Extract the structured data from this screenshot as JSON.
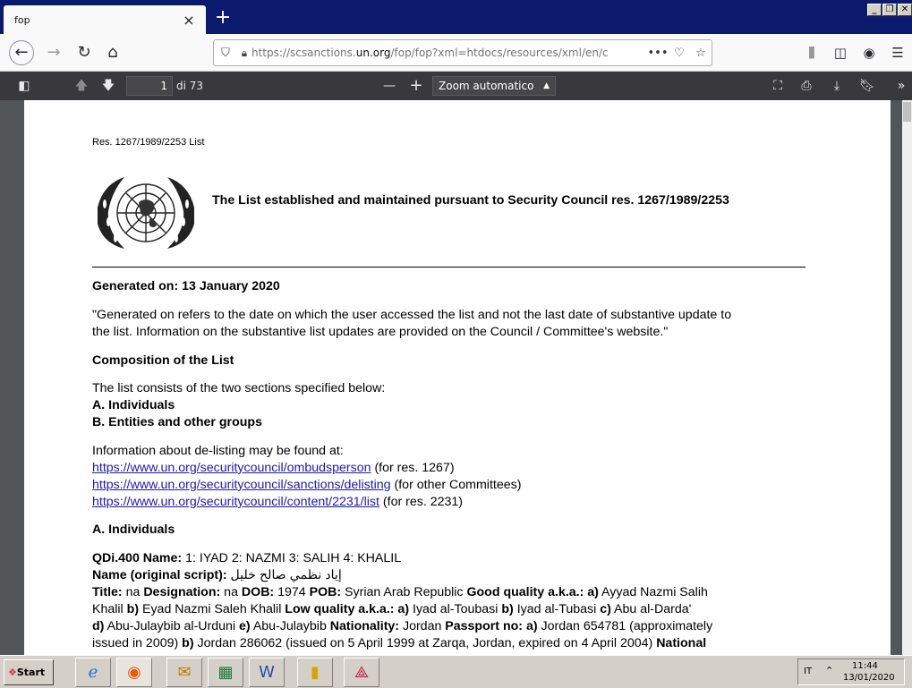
{
  "browser": {
    "tab_title": "fop",
    "tab_close": "×",
    "new_tab": "+",
    "url_prefix": "https://scsanctions.",
    "url_domain": "un.org",
    "url_rest": "/fop/fop?xml=htdocs/resources/xml/en/c",
    "more_actions": "•••"
  },
  "pdf_toolbar": {
    "page_number": "1",
    "page_count": "di 73",
    "zoom_out": "—",
    "zoom_in": "+",
    "zoom_value": "Zoom automatico"
  },
  "document": {
    "header_ref": "Res. 1267/1989/2253 List",
    "main_title": "The List established and maintained pursuant to Security Council res. 1267/1989/2253",
    "generated_on": "Generated on: 13 January 2020",
    "generated_note_1": "\"Generated on refers to the date on which the user accessed the list and not the last date of substantive update to",
    "generated_note_2": "the list. Information on the substantive list updates are provided on the Council / Committee's website.\"",
    "composition_heading": "Composition of the List",
    "composition_intro": "The list consists of the two sections specified below:",
    "section_a": "A. Individuals",
    "section_b": "B. Entities and other groups",
    "delisting_intro": "Information about de-listing may be found at:",
    "links": [
      {
        "url": "https://www.un.org/securitycouncil/ombudsperson",
        "note": " (for res. 1267)"
      },
      {
        "url": "https://www.un.org/securitycouncil/sanctions/delisting",
        "note": " (for other Committees)"
      },
      {
        "url": "https://www.un.org/securitycouncil/content/2231/list",
        "note": " (for res. 2231)"
      }
    ],
    "individuals_heading": "A. Individuals",
    "entry": {
      "ref_label": "QDi.400 Name:",
      "ref_value": " 1: IYAD 2: NAZMI 3: SALIH 4: KHALIL",
      "orig_label": "Name (original script):",
      "orig_value": " إياد نظمي صالح خليل",
      "title_label": "Title:",
      "title_value": " na ",
      "designation_label": "Designation:",
      "designation_value": " na ",
      "dob_label": "DOB:",
      "dob_value": " 1974 ",
      "pob_label": "POB:",
      "pob_value": " Syrian Arab Republic ",
      "good_aka_label": "Good quality a.k.a.: a)",
      "good_aka_value": " Ayyad Nazmi Salih",
      "line2_a": "Khalil ",
      "line2_b_label": "b)",
      "line2_b_value": " Eyad Nazmi Saleh Khalil ",
      "low_aka_label": "Low quality a.k.a.: a)",
      "low_aka_value": " Iyad al-Toubasi ",
      "low_b_label": "b)",
      "low_b_value": " Iyad al-Tubasi ",
      "low_c_label": "c)",
      "low_c_value": " Abu al-Darda'",
      "line3_d_label": "d)",
      "line3_d_value": " Abu-Julaybib al-Urduni ",
      "line3_e_label": "e)",
      "line3_e_value": " Abu-Julaybib ",
      "nationality_label": "Nationality:",
      "nationality_value": " Jordan ",
      "passport_label": "Passport no: a)",
      "passport_value": " Jordan 654781 (approximately",
      "line4_a": "issued in 2009) ",
      "line4_b_label": "b)",
      "line4_b_value": " Jordan 286062 (issued on 5 April 1999 at Zarqa, Jordan, expired on 4 April 2004) ",
      "line4_national": "National"
    }
  },
  "taskbar": {
    "start_label": "Start",
    "lang": "IT",
    "time": "11:44",
    "date": "13/01/2020"
  }
}
